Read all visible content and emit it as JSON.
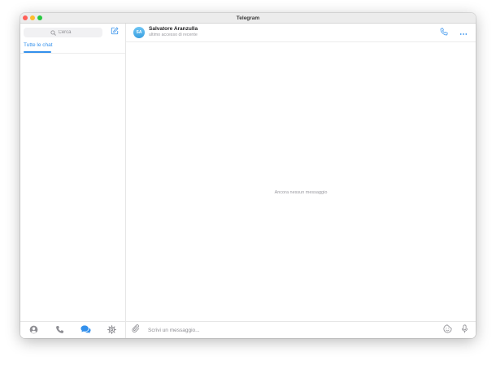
{
  "window": {
    "title": "Telegram",
    "traffic_colors": {
      "close": "#ff5f57",
      "minimize": "#febc2e",
      "zoom": "#28c840"
    }
  },
  "sidebar": {
    "search_placeholder": "Cerca",
    "folder_tab": "Tutte le chat",
    "bottom_nav": [
      {
        "name": "contacts",
        "icon": "person-icon",
        "active": false
      },
      {
        "name": "calls",
        "icon": "phone-icon",
        "active": false
      },
      {
        "name": "chats",
        "icon": "chat-bubbles-icon",
        "active": true
      },
      {
        "name": "settings",
        "icon": "gear-icon",
        "active": false
      }
    ]
  },
  "chat": {
    "contact": {
      "initials": "SA",
      "name": "Salvatore Aranzulla",
      "status": "ultimo accesso di recente"
    },
    "empty_text": "Ancora nessun messaggio",
    "composer_placeholder": "Scrivi un messaggio..."
  },
  "colors": {
    "accent": "#3390ec",
    "icon_gray": "#8e8e93",
    "text_muted": "#9a9aa0"
  }
}
